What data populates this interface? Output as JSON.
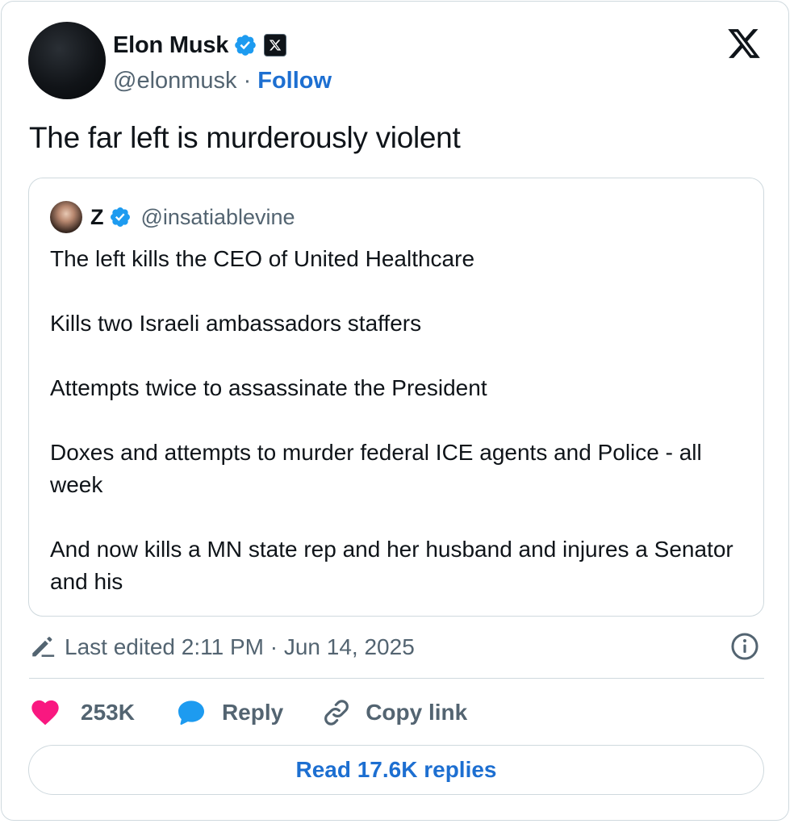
{
  "author": {
    "name": "Elon Musk",
    "handle": "@elonmusk",
    "separator": "·",
    "follow_label": "Follow",
    "verified_icon": "verified-badge-icon",
    "affiliate_icon": "x-affiliate-badge-icon"
  },
  "brand_icon": "x-logo-icon",
  "tweet": {
    "text": "The far left is murderously violent"
  },
  "quoted": {
    "name": "Z",
    "handle": "@insatiablevine",
    "paragraphs": [
      "The left kills the CEO of United Healthcare",
      "Kills two Israeli ambassadors staffers",
      "Attempts twice to assassinate the President",
      "Doxes and attempts to murder federal ICE agents and Police - all week",
      "And now kills a MN state rep and her husband and injures a Senator and his"
    ]
  },
  "meta": {
    "edited_text": "Last edited 2:11 PM · Jun 14, 2025",
    "edit_icon": "pencil-icon",
    "info_icon": "info-icon"
  },
  "actions": {
    "likes": "253K",
    "reply_label": "Reply",
    "copy_label": "Copy link"
  },
  "read_replies_label": "Read 17.6K replies",
  "colors": {
    "accent": "#1d6fd1",
    "verified": "#1d9bf0",
    "like": "#f91880",
    "muted": "#536471",
    "border": "#cfd9de"
  }
}
